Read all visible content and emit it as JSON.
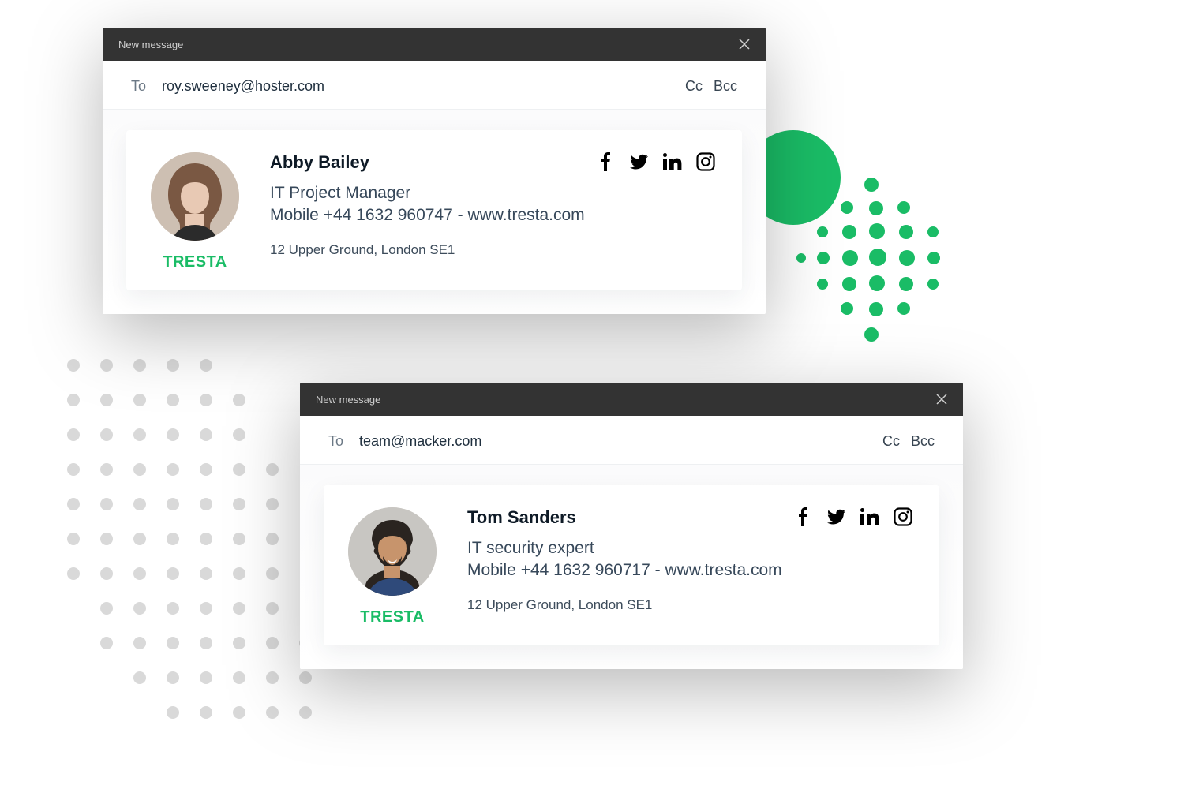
{
  "window1": {
    "title": "New message",
    "to_label": "To",
    "to": "roy.sweeney@hoster.com",
    "cc": "Cc",
    "bcc": "Bcc",
    "sig": {
      "name": "Abby Bailey",
      "role": "IT Project Manager",
      "contact": "Mobile +44 1632 960747 - www.tresta.com",
      "address": "12 Upper Ground, London SE1",
      "company": "TRESTA"
    }
  },
  "window2": {
    "title": "New message",
    "to_label": "To",
    "to": "team@macker.com",
    "cc": "Cc",
    "bcc": "Bcc",
    "sig": {
      "name": "Tom Sanders",
      "role": "IT security expert",
      "contact": "Mobile +44 1632 960717 - www.tresta.com",
      "address": "12 Upper Ground, London SE1",
      "company": "TRESTA"
    }
  },
  "colors": {
    "accent": "#1abc66",
    "grey": "#d9d9d9"
  }
}
